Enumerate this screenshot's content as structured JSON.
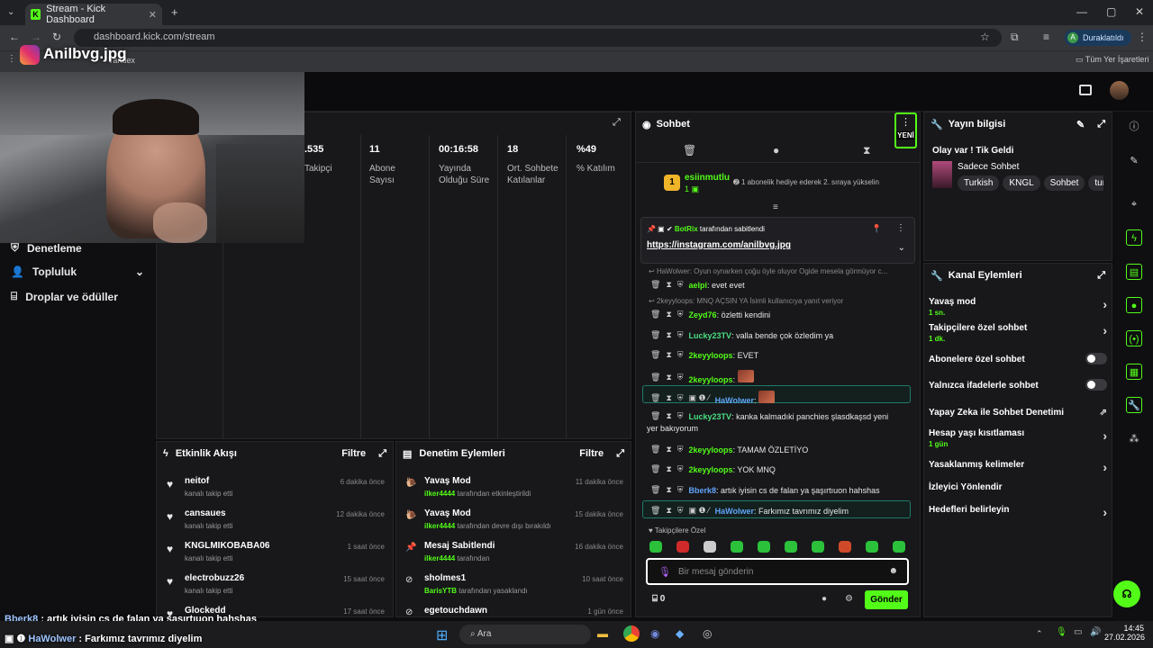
{
  "browser": {
    "tab_title": "Stream - Kick Dashboard",
    "url": "dashboard.kick.com/stream",
    "profile": "Duraklatıldı",
    "profile_initial": "A",
    "bookmarks_right": "Tüm Yer İşaretleri",
    "bookmark_yandex": "Yandex"
  },
  "overlay": {
    "brand": "Anilbvg.jpg"
  },
  "sidebar": {
    "items": [
      {
        "label": "Denetleme"
      },
      {
        "label": "Topluluk"
      },
      {
        "label": "Droplar ve ödüller"
      }
    ]
  },
  "stats": [
    {
      "value": ".535",
      "label": "Takipçi"
    },
    {
      "value": "11",
      "label": "Abone Sayısı"
    },
    {
      "value": "00:16:58",
      "label": "Yayında Olduğu Süre"
    },
    {
      "value": "18",
      "label": "Ort. Sohbete Katılanlar"
    },
    {
      "value": "%49",
      "label": "% Katılım"
    }
  ],
  "activity": {
    "title": "Etkinlik Akışı",
    "filter": "Filtre",
    "items": [
      {
        "name": "neitof",
        "sub": "kanalı takip etti",
        "time": "6 dakika önce"
      },
      {
        "name": "cansaues",
        "sub": "kanalı takip etti",
        "time": "12 dakika önce"
      },
      {
        "name": "KNGLMIKOBABA06",
        "sub": "kanalı takip etti",
        "time": "1 saat önce"
      },
      {
        "name": "electrobuzz26",
        "sub": "kanalı takip etti",
        "time": "15 saat önce"
      },
      {
        "name": "Glockedd",
        "sub": "",
        "time": "17 saat önce"
      }
    ]
  },
  "moderation": {
    "title": "Denetim Eylemleri",
    "filter": "Filtre",
    "items": [
      {
        "name": "Yavaş Mod",
        "actor": "ilker4444",
        "sub": " tarafından etkinleştirildi",
        "time": "11 dakika önce"
      },
      {
        "name": "Yavaş Mod",
        "actor": "ilker4444",
        "sub": " tarafından devre dışı bırakıldı",
        "time": "15 dakika önce"
      },
      {
        "name": "Mesaj Sabitlendi",
        "actor": "ilker4444",
        "sub": " tarafından",
        "time": "16 dakika önce"
      },
      {
        "name": "sholmes1",
        "actor": "BarisYTB",
        "sub": " tarafından yasaklandı",
        "time": "10 saat önce"
      },
      {
        "name": "egetouchdawn",
        "actor": "",
        "sub": "",
        "time": "1 gün önce"
      }
    ]
  },
  "chat": {
    "title": "Sohbet",
    "new_badge": "YENİ",
    "hype": {
      "user": "esiinmutlu",
      "count": "1",
      "text": "1 abonelik hediye ederek 2. sıraya yükselin"
    },
    "pinned": {
      "by": "BotRix",
      "by_text": " tarafından sabitlendi",
      "link": "https://instagram.com/anilbvg.jpg"
    },
    "messages": [
      {
        "reply": "HaWolwer: Oyun oynarken çoğu öyle oluyor Ogide mesela görmüyor c..."
      },
      {
        "user": "aelpi",
        "text": ": evet evet",
        "color": "#53fc18"
      },
      {
        "reply": "2keyyloops: MNQ AÇSIN YA İsimli kullanıcıya yanıt veriyor"
      },
      {
        "user": "Zeyd76",
        "text": ": özletti kendini",
        "color": "#53fc18"
      },
      {
        "user": "Lucky23TV",
        "text": ": valla bende çok özledim ya",
        "color": "#4ade80"
      },
      {
        "user": "2keyyloops",
        "text": ": EVET",
        "color": "#53fc18"
      },
      {
        "user": "2keyyloops",
        "text": ": ",
        "color": "#53fc18",
        "emote": true
      },
      {
        "user": "HaWolwer",
        "text": ": ",
        "color": "#60a5fa",
        "emote": true,
        "hl": true
      },
      {
        "user": "Lucky23TV",
        "text": ": kanka kalmadıki panchies şlasdkaşsd yeni",
        "color": "#4ade80",
        "cont": "yer bakıyorum"
      },
      {
        "user": "2keyyloops",
        "text": ": TAMAM ÖZLETİYO",
        "color": "#53fc18"
      },
      {
        "user": "2keyyloops",
        "text": ": YOK MNQ",
        "color": "#53fc18"
      },
      {
        "user": "Bberk8",
        "text": ": artık iyisin cs de falan ya şaşırtıuon hahshas",
        "color": "#60a5fa"
      },
      {
        "user": "HaWolwer",
        "text": ": Farkımız tavrımız diyelim",
        "color": "#60a5fa",
        "hl": true
      }
    ],
    "followers_only": "Takipçilere Özel",
    "placeholder": "Bir mesaj gönderin",
    "count": "0",
    "send": "Gönder"
  },
  "stream_info": {
    "title": "Yayın bilgisi",
    "stream_title": "Olay var ! Tik Geldi",
    "category": "Sadece Sohbet",
    "tags": [
      "Turkish",
      "KNGL",
      "Sohbet",
      "turk"
    ]
  },
  "channel_actions": {
    "title": "Kanal Eylemleri",
    "items": [
      {
        "label": "Yavaş mod",
        "sub": "1 sn.",
        "kind": "chev"
      },
      {
        "label": "Takipçilere özel sohbet",
        "sub": "1 dk.",
        "kind": "chev"
      },
      {
        "label": "Abonelere özel sohbet",
        "sub": "",
        "kind": "toggle"
      },
      {
        "label": "Yalnızca ifadelerle sohbet",
        "sub": "",
        "kind": "toggle"
      },
      {
        "label": "Yapay Zeka ile Sohbet Denetimi",
        "sub": "",
        "kind": "ext"
      },
      {
        "label": "Hesap yaşı kısıtlaması",
        "sub": "1 gün",
        "kind": "chev"
      },
      {
        "label": "Yasaklanmış kelimeler",
        "sub": "",
        "kind": "chev"
      },
      {
        "label": "İzleyici Yönlendir",
        "sub": "",
        "kind": "none"
      },
      {
        "label": "Hedefleri belirleyin",
        "sub": "",
        "kind": "chev"
      }
    ]
  },
  "overlay_chat": [
    {
      "user": "Bberk8",
      "text": " : artık iyisin cs de falan ya şaşırtıuon hahshas"
    },
    {
      "user": "HaWolwer",
      "text": " : Farkımız tavrımız diyelim"
    }
  ],
  "taskbar": {
    "search": "Ara",
    "time": "14:45",
    "date": "27.02.2026"
  }
}
